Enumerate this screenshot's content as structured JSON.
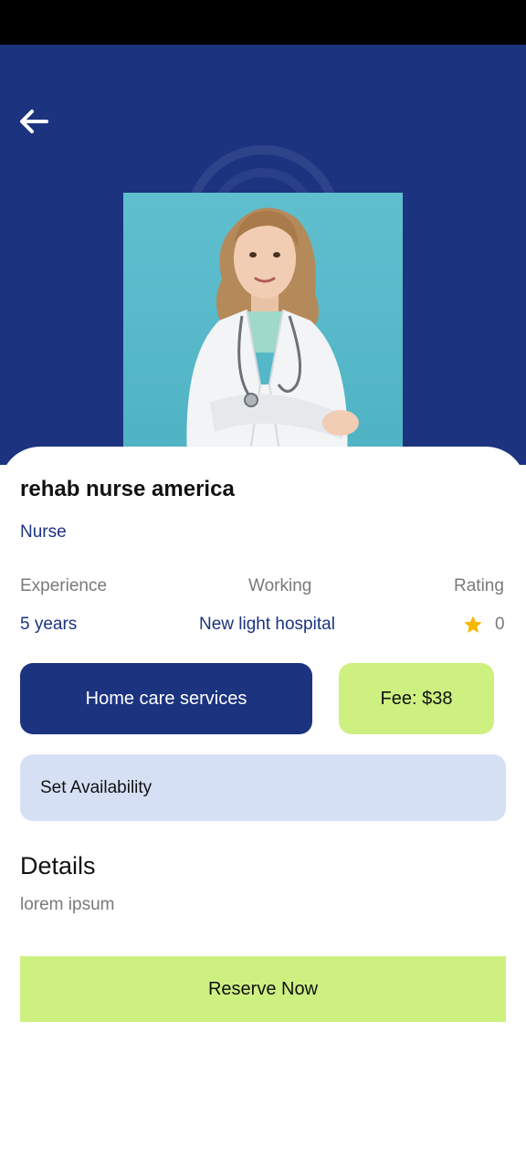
{
  "profile": {
    "name": "rehab nurse america",
    "role": "Nurse"
  },
  "stats": {
    "experience_label": "Experience",
    "experience_value": "5 years",
    "working_label": "Working",
    "working_value": "New light hospital",
    "rating_label": "Rating",
    "rating_value": "0"
  },
  "actions": {
    "service_label": "Home care services",
    "fee_label": "Fee: $38",
    "availability_label": "Set Availability",
    "reserve_label": "Reserve Now"
  },
  "details": {
    "title": "Details",
    "text": "lorem ipsum"
  },
  "colors": {
    "primary": "#1c3380",
    "accent": "#cdf081",
    "light_blue": "#d6e0f5",
    "star": "#f5b800"
  },
  "icons": {
    "back": "arrow-left-icon",
    "rating": "star-icon"
  }
}
